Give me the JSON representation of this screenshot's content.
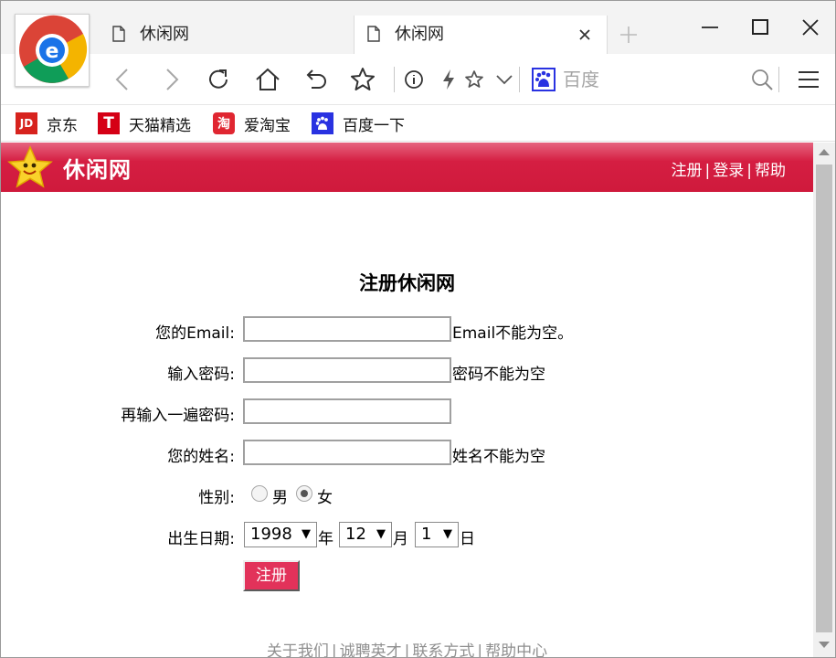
{
  "browser": {
    "tabs": [
      {
        "label": "休闲网",
        "active": false
      },
      {
        "label": "休闲网",
        "active": true
      }
    ],
    "search_engine": "百度",
    "bookmarks": [
      {
        "label": "京东",
        "icon": "jd-icon",
        "icon_text": "JD",
        "color": "#d7231e"
      },
      {
        "label": "天猫精选",
        "icon": "tmall-icon",
        "icon_text": "T",
        "color": "#d50015"
      },
      {
        "label": "爱淘宝",
        "icon": "taobao-icon",
        "icon_text": "淘",
        "color": "#e02631"
      },
      {
        "label": "百度一下",
        "icon": "baidu-paw-icon",
        "icon_text": "",
        "color": "#2932e1"
      }
    ]
  },
  "site": {
    "name": "休闲网",
    "header_color": "#d51e42",
    "nav": {
      "register": "注册",
      "login": "登录",
      "help": "帮助",
      "sep": "|"
    }
  },
  "form": {
    "title": "注册休闲网",
    "fields": {
      "email": {
        "label": "您的Email:",
        "value": "",
        "error": "Email不能为空。"
      },
      "password": {
        "label": "输入密码:",
        "value": "",
        "error": "密码不能为空"
      },
      "confirm": {
        "label": "再输入一遍密码:",
        "value": ""
      },
      "name": {
        "label": "您的姓名:",
        "value": "",
        "error": "姓名不能为空"
      }
    },
    "gender": {
      "label": "性别:",
      "options": [
        "男",
        "女"
      ],
      "selected": "女"
    },
    "birthday": {
      "label": "出生日期:",
      "year": "1998",
      "month": "12",
      "day": "1",
      "year_unit": "年",
      "month_unit": "月",
      "day_unit": "日"
    },
    "submit": "注册"
  },
  "footer": {
    "links": [
      "关于我们",
      "诚聘英才",
      "联系方式",
      "帮助中心"
    ],
    "sep": "|"
  }
}
